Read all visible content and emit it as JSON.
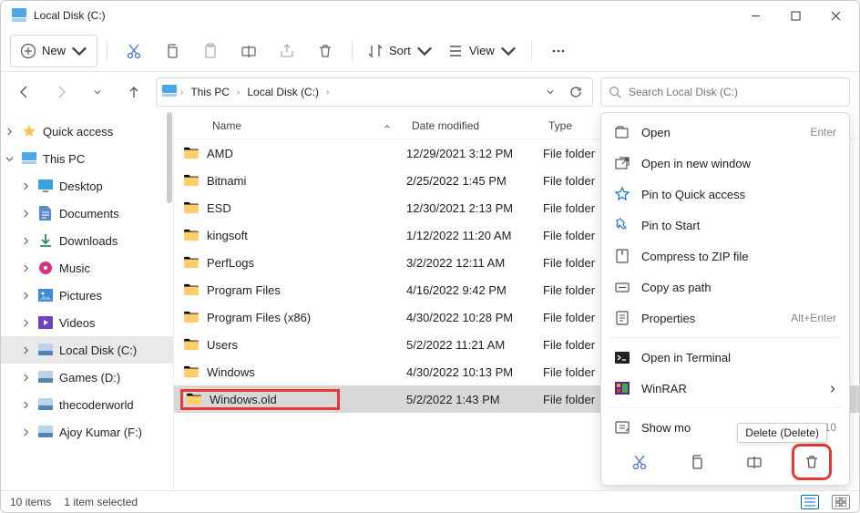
{
  "title": "Local Disk (C:)",
  "toolbar": {
    "new_label": "New",
    "sort_label": "Sort",
    "view_label": "View"
  },
  "breadcrumb": [
    "This PC",
    "Local Disk (C:)"
  ],
  "search_placeholder": "Search Local Disk (C:)",
  "sidebar": {
    "items": [
      {
        "label": "Quick access",
        "expanded_icon": "chev-right",
        "indent": 0,
        "icon": "star"
      },
      {
        "label": "This PC",
        "expanded_icon": "chev-down",
        "indent": 0,
        "icon": "pc"
      },
      {
        "label": "Desktop",
        "expanded_icon": "chev-right",
        "indent": 1,
        "icon": "desktop"
      },
      {
        "label": "Documents",
        "expanded_icon": "chev-right",
        "indent": 1,
        "icon": "documents"
      },
      {
        "label": "Downloads",
        "expanded_icon": "chev-right",
        "indent": 1,
        "icon": "downloads"
      },
      {
        "label": "Music",
        "expanded_icon": "chev-right",
        "indent": 1,
        "icon": "music"
      },
      {
        "label": "Pictures",
        "expanded_icon": "chev-right",
        "indent": 1,
        "icon": "pictures"
      },
      {
        "label": "Videos",
        "expanded_icon": "chev-right",
        "indent": 1,
        "icon": "videos"
      },
      {
        "label": "Local Disk (C:)",
        "expanded_icon": "chev-right",
        "indent": 1,
        "icon": "disk",
        "selected": true
      },
      {
        "label": "Games (D:)",
        "expanded_icon": "chev-right",
        "indent": 1,
        "icon": "disk"
      },
      {
        "label": "thecoderworld",
        "expanded_icon": "chev-right",
        "indent": 1,
        "icon": "disk"
      },
      {
        "label": "Ajoy Kumar (F:)",
        "expanded_icon": "chev-right",
        "indent": 1,
        "icon": "disk"
      }
    ]
  },
  "columns": {
    "name": "Name",
    "date": "Date modified",
    "type": "Type"
  },
  "files": [
    {
      "name": "AMD",
      "date": "12/29/2021 3:12 PM",
      "type": "File folder"
    },
    {
      "name": "Bitnami",
      "date": "2/25/2022 1:45 PM",
      "type": "File folder"
    },
    {
      "name": "ESD",
      "date": "12/30/2021 2:13 PM",
      "type": "File folder"
    },
    {
      "name": "kingsoft",
      "date": "1/12/2022 11:20 AM",
      "type": "File folder"
    },
    {
      "name": "PerfLogs",
      "date": "3/2/2022 12:11 AM",
      "type": "File folder"
    },
    {
      "name": "Program Files",
      "date": "4/16/2022 9:42 PM",
      "type": "File folder"
    },
    {
      "name": "Program Files (x86)",
      "date": "4/30/2022 10:28 PM",
      "type": "File folder"
    },
    {
      "name": "Users",
      "date": "5/2/2022 11:21 AM",
      "type": "File folder"
    },
    {
      "name": "Windows",
      "date": "4/30/2022 10:13 PM",
      "type": "File folder"
    },
    {
      "name": "Windows.old",
      "date": "5/2/2022 1:43 PM",
      "type": "File folder",
      "selected": true,
      "highlight": true
    }
  ],
  "context_menu": [
    {
      "label": "Open",
      "icon": "open",
      "accel": "Enter"
    },
    {
      "label": "Open in new window",
      "icon": "newwin"
    },
    {
      "label": "Pin to Quick access",
      "icon": "star-o"
    },
    {
      "label": "Pin to Start",
      "icon": "pin"
    },
    {
      "label": "Compress to ZIP file",
      "icon": "zip"
    },
    {
      "label": "Copy as path",
      "icon": "copypath"
    },
    {
      "label": "Properties",
      "icon": "props",
      "accel": "Alt+Enter"
    },
    {
      "sep": true
    },
    {
      "label": "Open in Terminal",
      "icon": "terminal"
    },
    {
      "label": "WinRAR",
      "icon": "winrar",
      "submenu": true
    },
    {
      "sep": true
    },
    {
      "label": "Show mo",
      "icon": "showmore",
      "accel": "Shift+F10"
    }
  ],
  "tooltip": "Delete (Delete)",
  "status": {
    "count": "10 items",
    "selected": "1 item selected"
  }
}
